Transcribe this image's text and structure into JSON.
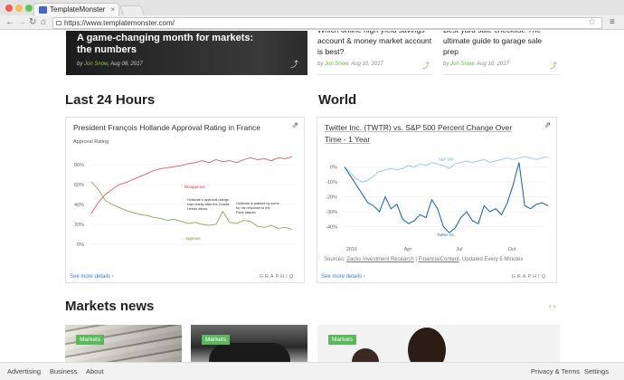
{
  "browser": {
    "tab_title": "TemplateMonster",
    "url": "https://www.templatemonster.com/"
  },
  "featured": {
    "title": "A game-changing month for markets: the numbers",
    "author": "Jon Snow",
    "date": "Aug 08, 2017"
  },
  "articles": [
    {
      "title": "Which online high-yield savings account & money market account is best?",
      "author": "Jon Snow",
      "date": "Aug 10, 2017"
    },
    {
      "title": "Best yard sale checklist: The ultimate guide to garage sale prep",
      "author": "Jon Snow",
      "date": "Aug 10, 2017"
    }
  ],
  "by_label": "by",
  "sections": {
    "last24": "Last 24 Hours",
    "world": "World",
    "markets_news": "Markets news"
  },
  "chart_left": {
    "title": "President François Hollande Approval Rating in France",
    "footer_link": "See more details ›",
    "brand": "GRAPHIQ"
  },
  "chart_right": {
    "title": "Twitter Inc. (TWTR) vs. S&P 500 Percent Change Over Time - 1 Year",
    "sources_prefix": "Sources: ",
    "source1": "Zacks Investment Research",
    "sep": " | ",
    "source2": "FinancialContent",
    "sources_suffix": ". Updated Every 5 Minutes",
    "footer_link": "See more details ›",
    "brand": "GRAPHIQ"
  },
  "news_badge": "Markets",
  "footer": {
    "left": [
      "Advertising",
      "Business",
      "About"
    ],
    "right": [
      "Privacy & Terms",
      "Settings"
    ]
  },
  "chart_data": [
    {
      "type": "line",
      "title": "President François Hollande Approval Rating in France",
      "ylabel": "Approval Rating",
      "ylim": [
        0,
        100
      ],
      "yticks": [
        "0%",
        "20%",
        "40%",
        "60%",
        "80%"
      ],
      "x": [
        0,
        1,
        2,
        3,
        4,
        5,
        6,
        7,
        8,
        9,
        10,
        11,
        12,
        13,
        14,
        15,
        16,
        17,
        18,
        19,
        20,
        21,
        22,
        23,
        24,
        25,
        26,
        27,
        28,
        29
      ],
      "series": [
        {
          "name": "Disapprove",
          "color": "#e05a5a",
          "values": [
            31,
            42,
            50,
            55,
            60,
            62,
            65,
            68,
            71,
            74,
            76,
            77,
            78,
            79,
            81,
            82,
            84,
            82,
            85,
            83,
            84,
            82,
            85,
            87,
            85,
            86,
            84,
            87,
            86,
            88
          ]
        },
        {
          "name": "Approve",
          "color": "#8aa85a",
          "values": [
            63,
            55,
            44,
            40,
            37,
            34,
            32,
            30,
            29,
            27,
            26,
            24,
            25,
            23,
            21,
            22,
            20,
            19,
            20,
            33,
            22,
            21,
            24,
            23,
            18,
            17,
            19,
            16,
            17,
            15
          ]
        }
      ],
      "grid": true,
      "annotations": [
        "Hollande's approval ratings rose briefly after the Charlie Hebdo attack",
        "Hollande is praised by some for his response to the Paris attacks"
      ]
    },
    {
      "type": "line",
      "title": "Twitter Inc. (TWTR) vs. S&P 500 Percent Change Over Time - 1 Year",
      "ylim": [
        -50,
        10
      ],
      "yticks": [
        "-40%",
        "-30%",
        "-20%",
        "-10%",
        "0%"
      ],
      "xticks": [
        "2016",
        "Apr",
        "Jul",
        "Oct"
      ],
      "series": [
        {
          "name": "S&P 500",
          "color": "#8cc8e8",
          "values": [
            0,
            -4,
            -8,
            -10,
            -9,
            -6,
            -3,
            -2,
            -1,
            -2,
            -1,
            1,
            0,
            2,
            1,
            3,
            2,
            1,
            -1,
            2,
            3,
            4,
            3,
            4,
            5,
            3,
            4,
            5,
            6,
            5,
            6,
            7,
            6,
            5,
            6,
            7
          ]
        },
        {
          "name": "Twitter Inc.",
          "color": "#1f6fad",
          "values": [
            0,
            -6,
            -12,
            -18,
            -24,
            -26,
            -30,
            -20,
            -28,
            -25,
            -35,
            -38,
            -36,
            -32,
            -34,
            -22,
            -28,
            -40,
            -44,
            -41,
            -34,
            -30,
            -36,
            -38,
            -26,
            -30,
            -28,
            -32,
            -24,
            -12,
            3,
            -26,
            -28,
            -25,
            -24,
            -26
          ]
        }
      ],
      "grid": true,
      "legend": "inline"
    }
  ]
}
